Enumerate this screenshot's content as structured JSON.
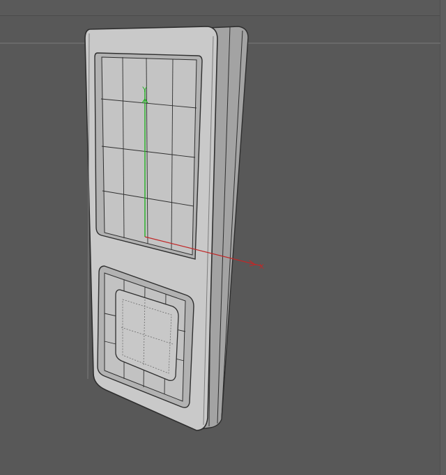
{
  "viewport": {
    "background": "#585858",
    "horizon_color": "#7a7a7a",
    "wire_color": "#2e2e2e",
    "surface_color": "#c9c9c9",
    "surface_shade": "#b6b6b6",
    "surface_dark": "#9d9d9d"
  },
  "gizmo": {
    "y_axis_label": "Y",
    "x_axis_label": "X",
    "y_axis_color": "#21b021",
    "x_axis_color": "#c02828"
  }
}
